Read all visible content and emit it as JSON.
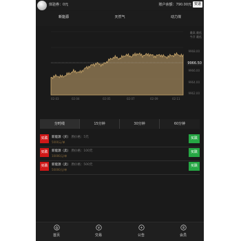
{
  "header": {
    "username": "体验券：0元",
    "balance": "账户余额：790.00元",
    "logout_label": "安退"
  },
  "product_tabs": [
    "新能源",
    "天然气",
    "动力煤"
  ],
  "chart_data": {
    "type": "area",
    "legend": [
      "最高 最低",
      "今开 最低"
    ],
    "current_price": "9966.50",
    "y_ticks": [
      "9968.00",
      "9966.00",
      "9964.00",
      "9962.00"
    ],
    "x_ticks": [
      "02:03",
      "02:04",
      "02:05",
      "02:07",
      "02:09",
      "02:11"
    ],
    "ylim": [
      9961,
      9970
    ],
    "values": [
      9963.5,
      9963.7,
      9963.6,
      9964.0,
      9964.4,
      9964.2,
      9964.8,
      9965.2,
      9965.5,
      9965.3,
      9965.9,
      9966.4,
      9966.2,
      9966.7,
      9966.5,
      9966.9,
      9966.6,
      9966.8,
      9966.5,
      9966.7,
      9966.4,
      9966.6,
      9966.8,
      9966.5
    ]
  },
  "period_tabs": [
    "分时线",
    "15分钟",
    "30分钟",
    "60分钟"
  ],
  "trades": [
    {
      "buy": "买跌",
      "name": "新能源（买）",
      "deposit": "原价格：5元",
      "price": "5000元/单",
      "sell": "买跌"
    },
    {
      "buy": "买跌",
      "name": "新能源（卖）",
      "deposit": "原价格：100元",
      "price": "10000元/单",
      "sell": "买跌"
    },
    {
      "buy": "买跌",
      "name": "新能源（卖）",
      "deposit": "原价格：500元",
      "price": "50000元/单",
      "sell": "买跌"
    }
  ],
  "nav": [
    {
      "label": "首页",
      "icon": "home-icon"
    },
    {
      "label": "交易",
      "icon": "trade-icon"
    },
    {
      "label": "公告",
      "icon": "notice-icon"
    },
    {
      "label": "会员",
      "icon": "member-icon"
    }
  ],
  "colors": {
    "buy": "#d01818",
    "sell": "#26a744",
    "accent": "#a68a5a"
  }
}
